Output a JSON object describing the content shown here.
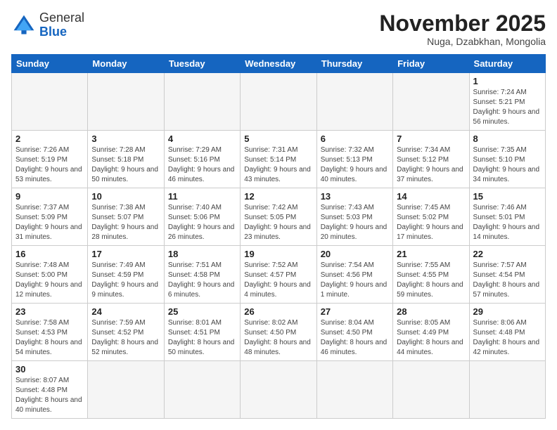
{
  "logo": {
    "general": "General",
    "blue": "Blue"
  },
  "title": "November 2025",
  "location": "Nuga, Dzabkhan, Mongolia",
  "weekdays": [
    "Sunday",
    "Monday",
    "Tuesday",
    "Wednesday",
    "Thursday",
    "Friday",
    "Saturday"
  ],
  "weeks": [
    [
      {
        "day": "",
        "info": ""
      },
      {
        "day": "",
        "info": ""
      },
      {
        "day": "",
        "info": ""
      },
      {
        "day": "",
        "info": ""
      },
      {
        "day": "",
        "info": ""
      },
      {
        "day": "",
        "info": ""
      },
      {
        "day": "1",
        "info": "Sunrise: 7:24 AM\nSunset: 5:21 PM\nDaylight: 9 hours and 56 minutes."
      }
    ],
    [
      {
        "day": "2",
        "info": "Sunrise: 7:26 AM\nSunset: 5:19 PM\nDaylight: 9 hours and 53 minutes."
      },
      {
        "day": "3",
        "info": "Sunrise: 7:28 AM\nSunset: 5:18 PM\nDaylight: 9 hours and 50 minutes."
      },
      {
        "day": "4",
        "info": "Sunrise: 7:29 AM\nSunset: 5:16 PM\nDaylight: 9 hours and 46 minutes."
      },
      {
        "day": "5",
        "info": "Sunrise: 7:31 AM\nSunset: 5:14 PM\nDaylight: 9 hours and 43 minutes."
      },
      {
        "day": "6",
        "info": "Sunrise: 7:32 AM\nSunset: 5:13 PM\nDaylight: 9 hours and 40 minutes."
      },
      {
        "day": "7",
        "info": "Sunrise: 7:34 AM\nSunset: 5:12 PM\nDaylight: 9 hours and 37 minutes."
      },
      {
        "day": "8",
        "info": "Sunrise: 7:35 AM\nSunset: 5:10 PM\nDaylight: 9 hours and 34 minutes."
      }
    ],
    [
      {
        "day": "9",
        "info": "Sunrise: 7:37 AM\nSunset: 5:09 PM\nDaylight: 9 hours and 31 minutes."
      },
      {
        "day": "10",
        "info": "Sunrise: 7:38 AM\nSunset: 5:07 PM\nDaylight: 9 hours and 28 minutes."
      },
      {
        "day": "11",
        "info": "Sunrise: 7:40 AM\nSunset: 5:06 PM\nDaylight: 9 hours and 26 minutes."
      },
      {
        "day": "12",
        "info": "Sunrise: 7:42 AM\nSunset: 5:05 PM\nDaylight: 9 hours and 23 minutes."
      },
      {
        "day": "13",
        "info": "Sunrise: 7:43 AM\nSunset: 5:03 PM\nDaylight: 9 hours and 20 minutes."
      },
      {
        "day": "14",
        "info": "Sunrise: 7:45 AM\nSunset: 5:02 PM\nDaylight: 9 hours and 17 minutes."
      },
      {
        "day": "15",
        "info": "Sunrise: 7:46 AM\nSunset: 5:01 PM\nDaylight: 9 hours and 14 minutes."
      }
    ],
    [
      {
        "day": "16",
        "info": "Sunrise: 7:48 AM\nSunset: 5:00 PM\nDaylight: 9 hours and 12 minutes."
      },
      {
        "day": "17",
        "info": "Sunrise: 7:49 AM\nSunset: 4:59 PM\nDaylight: 9 hours and 9 minutes."
      },
      {
        "day": "18",
        "info": "Sunrise: 7:51 AM\nSunset: 4:58 PM\nDaylight: 9 hours and 6 minutes."
      },
      {
        "day": "19",
        "info": "Sunrise: 7:52 AM\nSunset: 4:57 PM\nDaylight: 9 hours and 4 minutes."
      },
      {
        "day": "20",
        "info": "Sunrise: 7:54 AM\nSunset: 4:56 PM\nDaylight: 9 hours and 1 minute."
      },
      {
        "day": "21",
        "info": "Sunrise: 7:55 AM\nSunset: 4:55 PM\nDaylight: 8 hours and 59 minutes."
      },
      {
        "day": "22",
        "info": "Sunrise: 7:57 AM\nSunset: 4:54 PM\nDaylight: 8 hours and 57 minutes."
      }
    ],
    [
      {
        "day": "23",
        "info": "Sunrise: 7:58 AM\nSunset: 4:53 PM\nDaylight: 8 hours and 54 minutes."
      },
      {
        "day": "24",
        "info": "Sunrise: 7:59 AM\nSunset: 4:52 PM\nDaylight: 8 hours and 52 minutes."
      },
      {
        "day": "25",
        "info": "Sunrise: 8:01 AM\nSunset: 4:51 PM\nDaylight: 8 hours and 50 minutes."
      },
      {
        "day": "26",
        "info": "Sunrise: 8:02 AM\nSunset: 4:50 PM\nDaylight: 8 hours and 48 minutes."
      },
      {
        "day": "27",
        "info": "Sunrise: 8:04 AM\nSunset: 4:50 PM\nDaylight: 8 hours and 46 minutes."
      },
      {
        "day": "28",
        "info": "Sunrise: 8:05 AM\nSunset: 4:49 PM\nDaylight: 8 hours and 44 minutes."
      },
      {
        "day": "29",
        "info": "Sunrise: 8:06 AM\nSunset: 4:48 PM\nDaylight: 8 hours and 42 minutes."
      }
    ],
    [
      {
        "day": "30",
        "info": "Sunrise: 8:07 AM\nSunset: 4:48 PM\nDaylight: 8 hours and 40 minutes."
      },
      {
        "day": "",
        "info": ""
      },
      {
        "day": "",
        "info": ""
      },
      {
        "day": "",
        "info": ""
      },
      {
        "day": "",
        "info": ""
      },
      {
        "day": "",
        "info": ""
      },
      {
        "day": "",
        "info": ""
      }
    ]
  ]
}
